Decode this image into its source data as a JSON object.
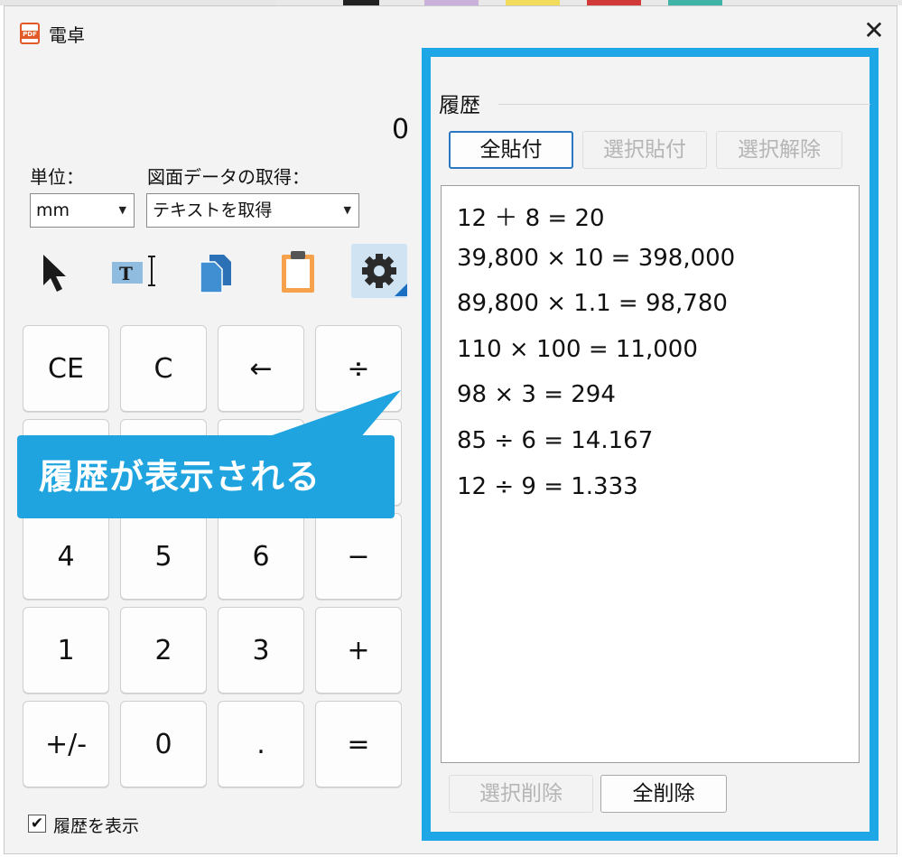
{
  "window": {
    "title": "電卓",
    "close_symbol": "✕",
    "app_icon_text": "PDF"
  },
  "display": {
    "value": "0"
  },
  "unit": {
    "label": "単位：",
    "selected": "mm"
  },
  "drawing_data": {
    "label": "図面データの取得：",
    "selected": "テキストを取得"
  },
  "toolbar": [
    "pointer-icon",
    "text-select-icon",
    "copy-icon",
    "clipboard-icon",
    "gear-icon"
  ],
  "keypad": [
    [
      "CE",
      "C",
      "←",
      "÷"
    ],
    [
      "4",
      "5",
      "6",
      "−"
    ],
    [
      "1",
      "2",
      "3",
      "+"
    ],
    [
      "+/-",
      "0",
      ".",
      "="
    ]
  ],
  "callout": {
    "text": "履歴が表示される",
    "color": "#1fa4e0"
  },
  "show_history": {
    "label": "履歴を表示",
    "checked": true,
    "check_symbol": "✔"
  },
  "history": {
    "title": "履歴",
    "paste_all": "全貼付",
    "paste_selected": "選択貼付",
    "deselect": "選択解除",
    "delete_selected": "選択削除",
    "delete_all": "全削除",
    "frame_color": "#1ea6e6",
    "items": [
      "12 ＋ 8 = 20",
      "39,800 × 10 = 398,000",
      "89,800 × 1.1 = 98,780",
      "110 × 100 = 11,000",
      "98 × 3 = 294",
      "85 ÷ 6 = 14.167",
      "12 ÷ 9 = 1.333"
    ]
  }
}
